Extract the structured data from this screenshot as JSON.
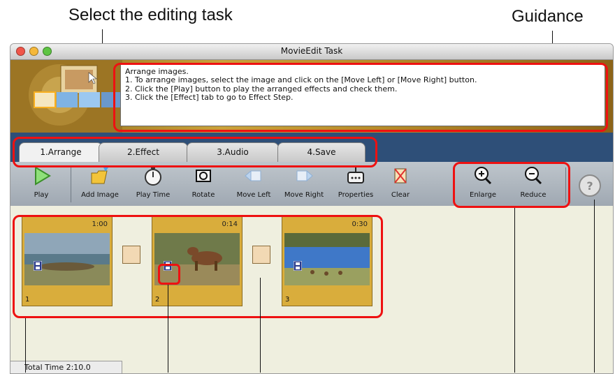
{
  "callouts": {
    "select_task": "Select the editing task",
    "guidance": "Guidance"
  },
  "window": {
    "title": "MovieEdit Task",
    "traffic_lights": [
      {
        "name": "close",
        "color": "#f0564a"
      },
      {
        "name": "minimize",
        "color": "#f5b83b"
      },
      {
        "name": "zoom",
        "color": "#5ec443"
      }
    ]
  },
  "guidance": {
    "lines": [
      "Arrange images.",
      "1. To arrange images, select the image and click on the [Move Left] or [Move Right] button.",
      "2. Click the [Play] button to play the arranged effects and check them.",
      "3. Click the [Effect] tab to go to Effect Step."
    ]
  },
  "tabs": [
    {
      "label": "1.Arrange",
      "active": true
    },
    {
      "label": "2.Effect",
      "active": false
    },
    {
      "label": "3.Audio",
      "active": false
    },
    {
      "label": "4.Save",
      "active": false
    }
  ],
  "toolbar": {
    "play": "Play",
    "add_image": "Add Image",
    "play_time": "Play Time",
    "rotate": "Rotate",
    "move_left": "Move Left",
    "move_right": "Move Right",
    "properties": "Properties",
    "clear": "Clear",
    "enlarge": "Enlarge",
    "reduce": "Reduce",
    "help_icon": "question-mark"
  },
  "clips": [
    {
      "index": "1",
      "duration": "1:00"
    },
    {
      "index": "2",
      "duration": "0:14"
    },
    {
      "index": "3",
      "duration": "0:30"
    }
  ],
  "status": {
    "total_time": "Total Time  2:10.0"
  },
  "colors": {
    "tab_bar": "#2e4f78",
    "highlight": "#e11111",
    "card_gold": "#d9ad3c"
  }
}
